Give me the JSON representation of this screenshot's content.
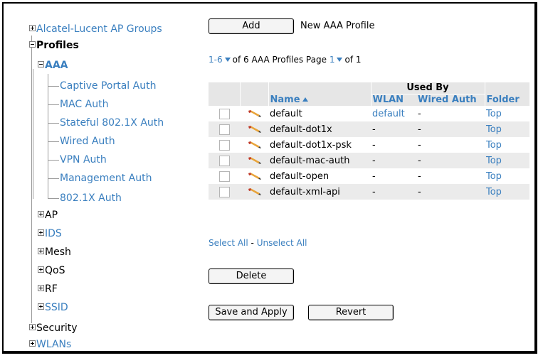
{
  "tree": {
    "ap_groups": "Alcatel-Lucent AP Groups",
    "profiles": "Profiles",
    "aaa": "AAA",
    "aaa_children": [
      "Captive Portal Auth",
      "MAC Auth",
      "Stateful 802.1X Auth",
      "Wired Auth",
      "VPN Auth",
      "Management Auth",
      "802.1X Auth"
    ],
    "ap": "AP",
    "ids": "IDS",
    "mesh": "Mesh",
    "qos": "QoS",
    "rf": "RF",
    "ssid": "SSID",
    "security": "Security",
    "wlans": "WLANs"
  },
  "toolbar": {
    "add_label": "Add",
    "new_profile_label": "New AAA Profile"
  },
  "pager": {
    "range": "1-6",
    "of_text": "of 6 AAA Profiles  Page",
    "page": "1",
    "page_of": "of 1"
  },
  "table": {
    "used_by_header": "Used By",
    "col_name": "Name",
    "col_wlan": "WLAN",
    "col_wired": "Wired Auth",
    "col_folder": "Folder",
    "rows": [
      {
        "name": "default",
        "wlan": "default",
        "wired": "-",
        "folder": "Top"
      },
      {
        "name": "default-dot1x",
        "wlan": "-",
        "wired": "-",
        "folder": "Top"
      },
      {
        "name": "default-dot1x-psk",
        "wlan": "-",
        "wired": "-",
        "folder": "Top"
      },
      {
        "name": "default-mac-auth",
        "wlan": "-",
        "wired": "-",
        "folder": "Top"
      },
      {
        "name": "default-open",
        "wlan": "-",
        "wired": "-",
        "folder": "Top"
      },
      {
        "name": "default-xml-api",
        "wlan": "-",
        "wired": "-",
        "folder": "Top"
      }
    ]
  },
  "selection": {
    "select_all": "Select All",
    "separator": " - ",
    "unselect_all": "Unselect All"
  },
  "actions": {
    "delete_label": "Delete",
    "save_apply_label": "Save and Apply",
    "revert_label": "Revert"
  },
  "colors": {
    "link": "#3a7fbf",
    "header_bg": "#e6e6e6",
    "alt_row_bg": "#ebebeb"
  }
}
